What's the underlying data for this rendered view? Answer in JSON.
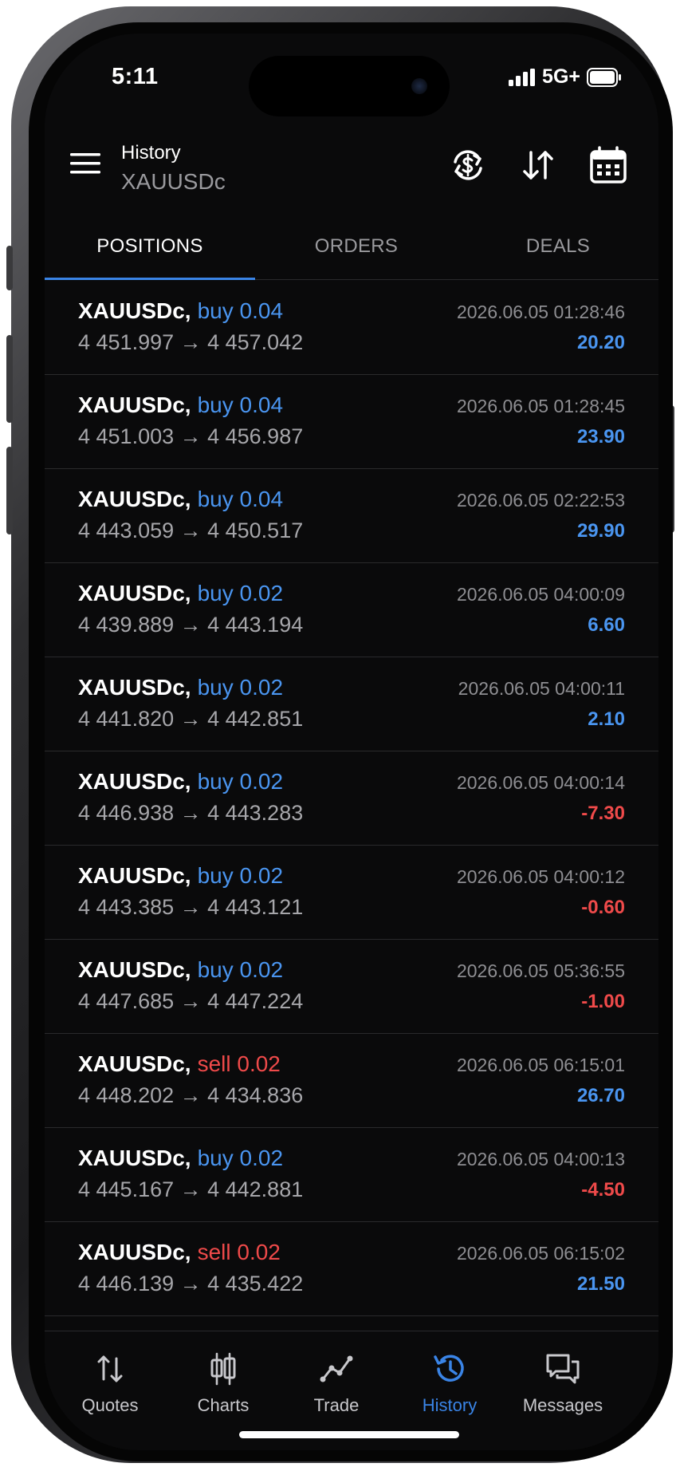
{
  "status_bar": {
    "time": "5:11",
    "network": "5G+"
  },
  "header": {
    "title": "History",
    "subtitle": "XAUUSDc"
  },
  "tabs": [
    {
      "label": "POSITIONS",
      "active": true
    },
    {
      "label": "ORDERS",
      "active": false
    },
    {
      "label": "DEALS",
      "active": false
    }
  ],
  "positions": [
    {
      "symbol": "XAUUSDc,",
      "side": "buy 0.04",
      "type": "buy",
      "prices": "4 451.997 → 4 457.042",
      "time": "2026.06.05 01:28:46",
      "profit": "20.20"
    },
    {
      "symbol": "XAUUSDc,",
      "side": "buy 0.04",
      "type": "buy",
      "prices": "4 451.003 → 4 456.987",
      "time": "2026.06.05 01:28:45",
      "profit": "23.90"
    },
    {
      "symbol": "XAUUSDc,",
      "side": "buy 0.04",
      "type": "buy",
      "prices": "4 443.059 → 4 450.517",
      "time": "2026.06.05 02:22:53",
      "profit": "29.90"
    },
    {
      "symbol": "XAUUSDc,",
      "side": "buy 0.02",
      "type": "buy",
      "prices": "4 439.889 → 4 443.194",
      "time": "2026.06.05 04:00:09",
      "profit": "6.60"
    },
    {
      "symbol": "XAUUSDc,",
      "side": "buy 0.02",
      "type": "buy",
      "prices": "4 441.820 → 4 442.851",
      "time": "2026.06.05 04:00:11",
      "profit": "2.10"
    },
    {
      "symbol": "XAUUSDc,",
      "side": "buy 0.02",
      "type": "buy",
      "prices": "4 446.938 → 4 443.283",
      "time": "2026.06.05 04:00:14",
      "profit": "-7.30"
    },
    {
      "symbol": "XAUUSDc,",
      "side": "buy 0.02",
      "type": "buy",
      "prices": "4 443.385 → 4 443.121",
      "time": "2026.06.05 04:00:12",
      "profit": "-0.60"
    },
    {
      "symbol": "XAUUSDc,",
      "side": "buy 0.02",
      "type": "buy",
      "prices": "4 447.685 → 4 447.224",
      "time": "2026.06.05 05:36:55",
      "profit": "-1.00"
    },
    {
      "symbol": "XAUUSDc,",
      "side": "sell 0.02",
      "type": "sell",
      "prices": "4 448.202 → 4 434.836",
      "time": "2026.06.05 06:15:01",
      "profit": "26.70"
    },
    {
      "symbol": "XAUUSDc,",
      "side": "buy 0.02",
      "type": "buy",
      "prices": "4 445.167 → 4 442.881",
      "time": "2026.06.05 04:00:13",
      "profit": "-4.50"
    },
    {
      "symbol": "XAUUSDc,",
      "side": "sell 0.02",
      "type": "sell",
      "prices": "4 446.139 → 4 435.422",
      "time": "2026.06.05 06:15:02",
      "profit": "21.50"
    }
  ],
  "bottom_nav": [
    {
      "label": "Quotes",
      "icon": "quotes-icon",
      "active": false
    },
    {
      "label": "Charts",
      "icon": "charts-icon",
      "active": false
    },
    {
      "label": "Trade",
      "icon": "trade-icon",
      "active": false
    },
    {
      "label": "History",
      "icon": "history-icon",
      "active": true
    },
    {
      "label": "Messages",
      "icon": "messages-icon",
      "active": false
    }
  ],
  "colors": {
    "accent": "#3a84e6",
    "buy": "#4a95f0",
    "sell": "#ef4a4a",
    "background": "#0a0a0b"
  }
}
